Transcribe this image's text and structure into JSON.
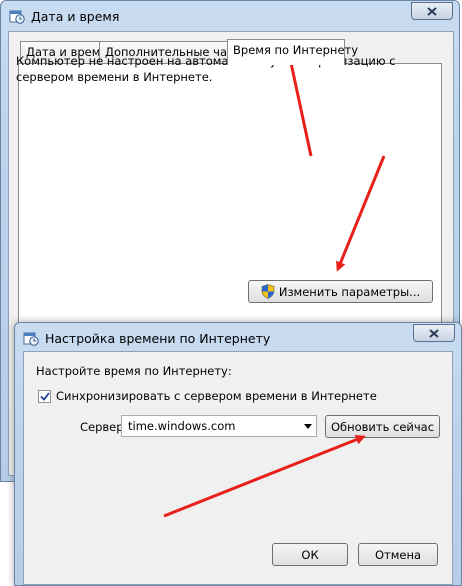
{
  "main_window": {
    "title": "Дата и время",
    "tabs": [
      {
        "label": "Дата и время"
      },
      {
        "label": "Дополнительные часы"
      },
      {
        "label": "Время по Интернету"
      }
    ],
    "message": "Компьютер не настроен на автоматическую синхронизацию с сервером времени в Интернете.",
    "change_button": "Изменить параметры..."
  },
  "dialog": {
    "title": "Настройка времени по Интернету",
    "prompt": "Настройте время по Интернету:",
    "sync_checkbox": {
      "label": "Синхронизировать с сервером времени в Интернете",
      "checked": true
    },
    "server_label": "Сервер:",
    "server_value": "time.windows.com",
    "update_button": "Обновить сейчас",
    "ok_button": "ОК",
    "cancel_button": "Отмена"
  },
  "colors": {
    "annotation_arrow": "#e8201a",
    "window_frame": "#bcd3ec"
  },
  "icons": [
    "clock-calendar-icon",
    "close-icon",
    "uac-shield-icon",
    "checkmark-icon",
    "dropdown-arrow-icon"
  ]
}
